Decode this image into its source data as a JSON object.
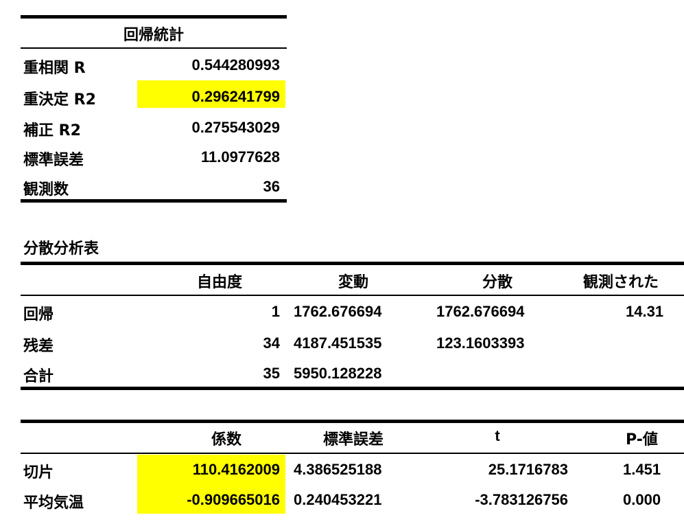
{
  "regression_stats": {
    "title": "回帰統計",
    "rows": [
      {
        "label": "重相関 R",
        "value": "0.544280993"
      },
      {
        "label": "重決定 R2",
        "value": "0.296241799"
      },
      {
        "label": "補正 R2",
        "value": "0.275543029"
      },
      {
        "label": "標準誤差",
        "value": "11.0977628"
      },
      {
        "label": "観測数",
        "value": "36"
      }
    ]
  },
  "anova": {
    "section_title": "分散分析表",
    "headers": [
      "自由度",
      "変動",
      "分散",
      "観測された"
    ],
    "rows": [
      {
        "label": "回帰",
        "df": "1",
        "ss": "1762.676694",
        "ms": "1762.676694",
        "f": "14.31"
      },
      {
        "label": "残差",
        "df": "34",
        "ss": "4187.451535",
        "ms": "123.1603393",
        "f": ""
      },
      {
        "label": "合計",
        "df": "35",
        "ss": "5950.128228",
        "ms": "",
        "f": ""
      }
    ]
  },
  "coefficients": {
    "headers": [
      "係数",
      "標準誤差",
      "t",
      "P-値"
    ],
    "rows": [
      {
        "label": "切片",
        "coef": "110.4162009",
        "se": "4.386525188",
        "t": "25.1716783",
        "p": "1.451"
      },
      {
        "label": "平均気温",
        "coef": "-0.909665016",
        "se": "0.240453221",
        "t": "-3.783126756",
        "p": "0.000"
      }
    ]
  },
  "highlight_color": "#ffff00"
}
